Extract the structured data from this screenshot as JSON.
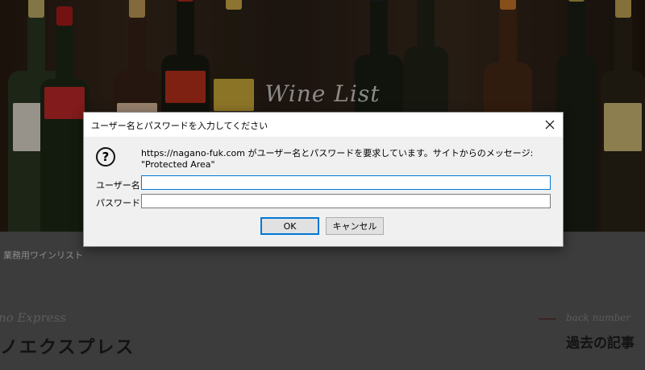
{
  "page": {
    "hero_title": "Wine List",
    "sub_label": "業務用ワインリスト",
    "express_en": "no Express",
    "express_jp": "ノエクスプレス",
    "back_en": "back number",
    "back_jp": "過去の記事"
  },
  "dialog": {
    "title": "ユーザー名とパスワードを入力してください",
    "close_glyph": "✕",
    "icon": "question-icon",
    "message_line1": "https://nagano-fuk.com がユーザー名とパスワードを要求しています。サイトからのメッセージ:",
    "message_line2": "\"Protected Area\"",
    "username_label": "ユーザー名:",
    "password_label": "パスワード:",
    "username_value": "",
    "password_value": "",
    "ok_label": "OK",
    "cancel_label": "キャンセル"
  },
  "colors": {
    "accent": "#0078d7",
    "dialog_bg": "#f0f0f0"
  }
}
